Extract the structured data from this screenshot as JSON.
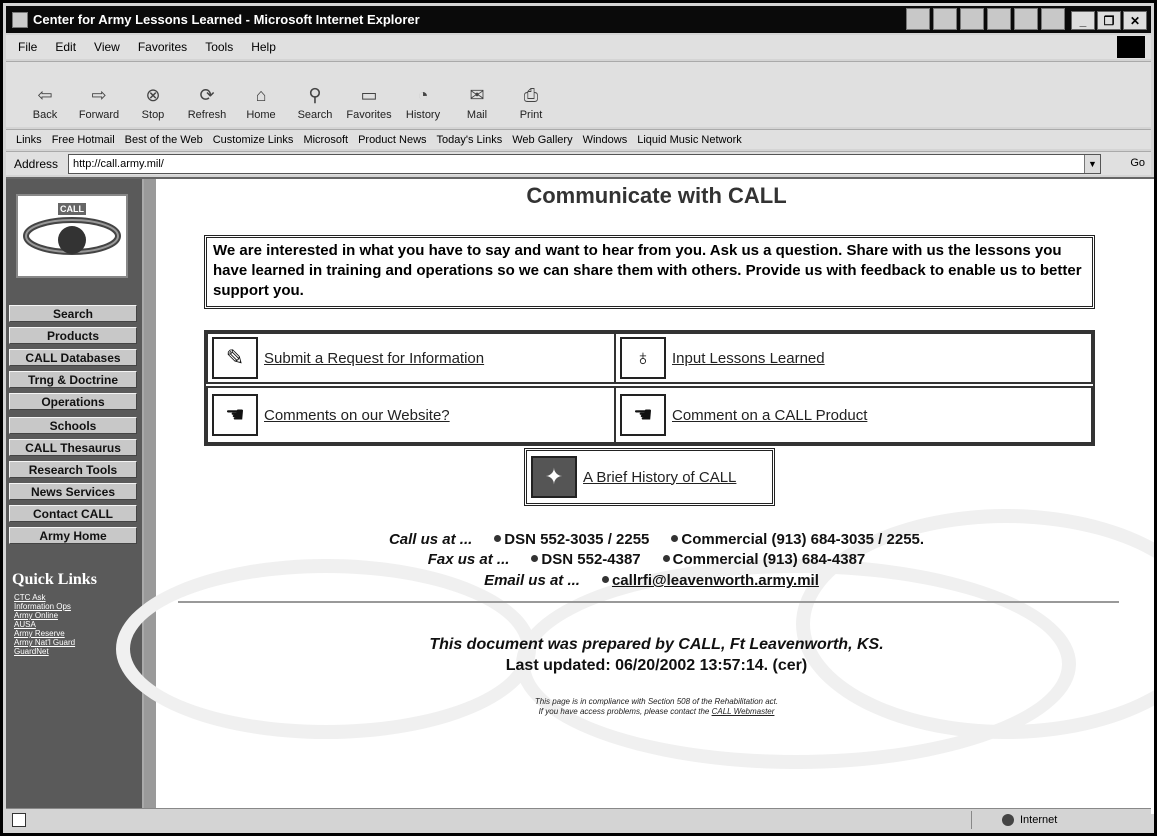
{
  "browser": {
    "title": "Center for Army Lessons Learned - Microsoft Internet Explorer",
    "menu": [
      "File",
      "Edit",
      "View",
      "Favorites",
      "Tools",
      "Help"
    ],
    "toolbar": [
      "Back",
      "Forward",
      "Stop",
      "Refresh",
      "Home",
      "Search",
      "Favorites",
      "History",
      "Mail",
      "Print"
    ],
    "links_label": "Links",
    "links": [
      "Free Hotmail",
      "Best of the Web",
      "Customize Links",
      "Microsoft",
      "Product News",
      "Today's Links",
      "Web Gallery",
      "Windows",
      "Liquid Music Network"
    ],
    "address_label": "Address",
    "address_value": "http://call.army.mil/",
    "go_label": "Go",
    "status_zone": "Internet",
    "icons": {
      "logo": "ie-logo",
      "close": "close-icon",
      "minimize": "minimize-icon",
      "maximize": "maximize-icon"
    }
  },
  "sidebar": {
    "logo_text": "CALL",
    "nav": [
      "Search",
      "Products",
      "CALL Databases",
      "Trng & Doctrine",
      "Operations",
      "Schools",
      "CALL Thesaurus",
      "Research Tools",
      "News Services",
      "Contact CALL",
      "Army Home"
    ],
    "quick_links_title": "Quick Links",
    "quick_links": [
      "CTC Ask",
      "Information Ops",
      "Army Online",
      "AUSA",
      "Army Reserve",
      "Army Nat'l Guard",
      "GuardNet"
    ]
  },
  "page": {
    "title": "Communicate with CALL",
    "intro": "We are interested in what you have to say and want to hear from you. Ask us a question. Share with us the lessons you have learned in training and operations so we can share them with others. Provide us with feedback to enable us to better support you.",
    "links": [
      {
        "label": "Submit a Request for Information",
        "icon": "form-icon"
      },
      {
        "label": "Input Lessons Learned",
        "icon": "lightbulb-icon"
      },
      {
        "label": "Comments on our Website?",
        "icon": "hand-icon"
      },
      {
        "label": "Comment on a CALL Product",
        "icon": "hand-icon"
      }
    ],
    "history_link": "A Brief History of CALL",
    "call_label": "Call us at ...",
    "call_dsn": "DSN 552-3035 / 2255",
    "call_commercial": "Commercial (913) 684-3035 / 2255.",
    "fax_label": "Fax us at ...",
    "fax_dsn": "DSN 552-4387",
    "fax_commercial": "Commercial (913) 684-4387",
    "email_label": "Email us at ...",
    "email": "callrfi@leavenworth.army.mil",
    "prepared": "This document was prepared by CALL, Ft Leavenworth, KS.",
    "updated": "Last updated: 06/20/2002 13:57:14. (cer)",
    "compliance_line1": "This page is in compliance with Section 508 of the Rehabilitation act.",
    "compliance_line2_prefix": "If you have access problems, please contact the",
    "webmaster": "CALL Webmaster"
  }
}
